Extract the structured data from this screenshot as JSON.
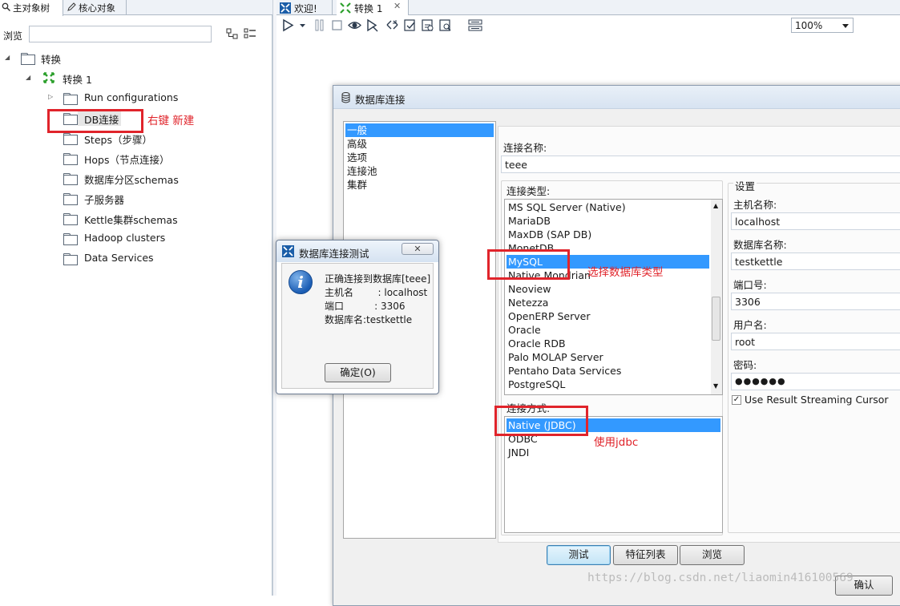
{
  "left_panel": {
    "tabs": [
      "主对象树",
      "核心对象"
    ],
    "browse_label": "浏览",
    "tree": {
      "root": "转换",
      "transform": "转换 1",
      "items": [
        "Run configurations",
        "DB连接",
        "Steps（步骤）",
        "Hops（节点连接）",
        "数据库分区schemas",
        "子服务器",
        "Kettle集群schemas",
        "Hadoop clusters",
        "Data Services"
      ]
    },
    "annotation": "右键 新建"
  },
  "main": {
    "tabs": [
      "欢迎!",
      "转换 1"
    ],
    "zoom": "100%"
  },
  "db_dialog": {
    "title": "数据库连接",
    "categories": [
      "一般",
      "高级",
      "选项",
      "连接池",
      "集群"
    ],
    "connection_name_label": "连接名称:",
    "connection_name_value": "teee",
    "connection_type_label": "连接类型:",
    "connection_types": [
      "MS SQL Server (Native)",
      "MariaDB",
      "MaxDB (SAP DB)",
      "MonetDB",
      "MySQL",
      "Native Mondrian",
      "Neoview",
      "Netezza",
      "OpenERP Server",
      "Oracle",
      "Oracle RDB",
      "Palo MOLAP Server",
      "Pentaho Data Services",
      "PostgreSQL"
    ],
    "selected_type": "MySQL",
    "access_label": "连接方式:",
    "access_methods": [
      "Native (JDBC)",
      "ODBC",
      "JNDI"
    ],
    "settings": {
      "legend": "设置",
      "host_label": "主机名称:",
      "host_value": "localhost",
      "db_label": "数据库名称:",
      "db_value": "testkettle",
      "port_label": "端口号:",
      "port_value": "3306",
      "user_label": "用户名:",
      "user_value": "root",
      "password_label": "密码:",
      "password_value": "●●●●●●",
      "streaming_label": "Use Result Streaming Cursor",
      "streaming_checked": "✓"
    },
    "buttons": {
      "test": "测试",
      "features": "特征列表",
      "browse": "浏览",
      "ok": "确认"
    },
    "annotation_type": "选择数据库类型",
    "annotation_jdbc": "使用jdbc"
  },
  "test_dialog": {
    "title": "数据库连接测试",
    "close": "✕",
    "line1": "正确连接到数据库[teee]",
    "line2": "主机名        : localhost",
    "line3": "端口          : 3306",
    "line4": "数据库名:testkettle",
    "ok_button": "确定(O)"
  },
  "watermark": "https://blog.csdn.net/liaomin416100569"
}
